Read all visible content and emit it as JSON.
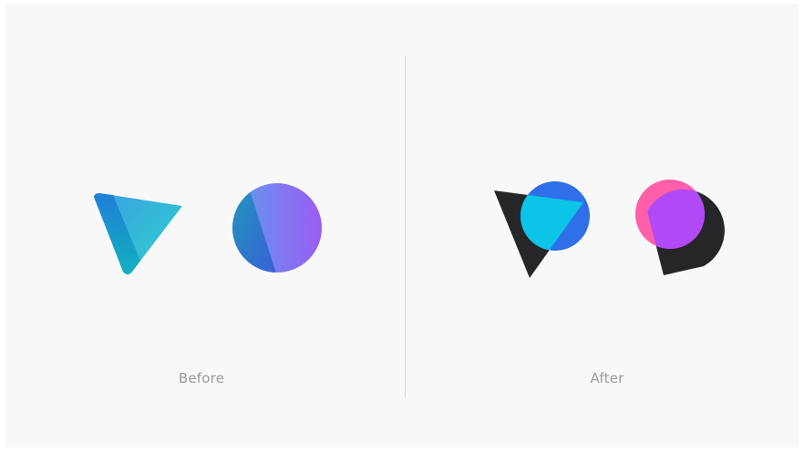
{
  "panels": {
    "before": {
      "caption": "Before",
      "icons": [
        "gradient-triangle-icon",
        "gradient-circle-icon"
      ]
    },
    "after": {
      "caption": "After",
      "icons": [
        "dark-triangle-blue-circle-icon",
        "pink-purple-circle-dark-drop-icon"
      ]
    }
  },
  "colors": {
    "background": "#f8f8f9",
    "divider": "#dadadc",
    "caption_text": "#9b9ba0",
    "teal": "#19b6c8",
    "blue": "#2f6fe8",
    "cyan": "#0bc4e8",
    "dark": "#262629",
    "pink": "#ff5fa8",
    "purple": "#b04af6",
    "violet": "#8a6df0"
  }
}
